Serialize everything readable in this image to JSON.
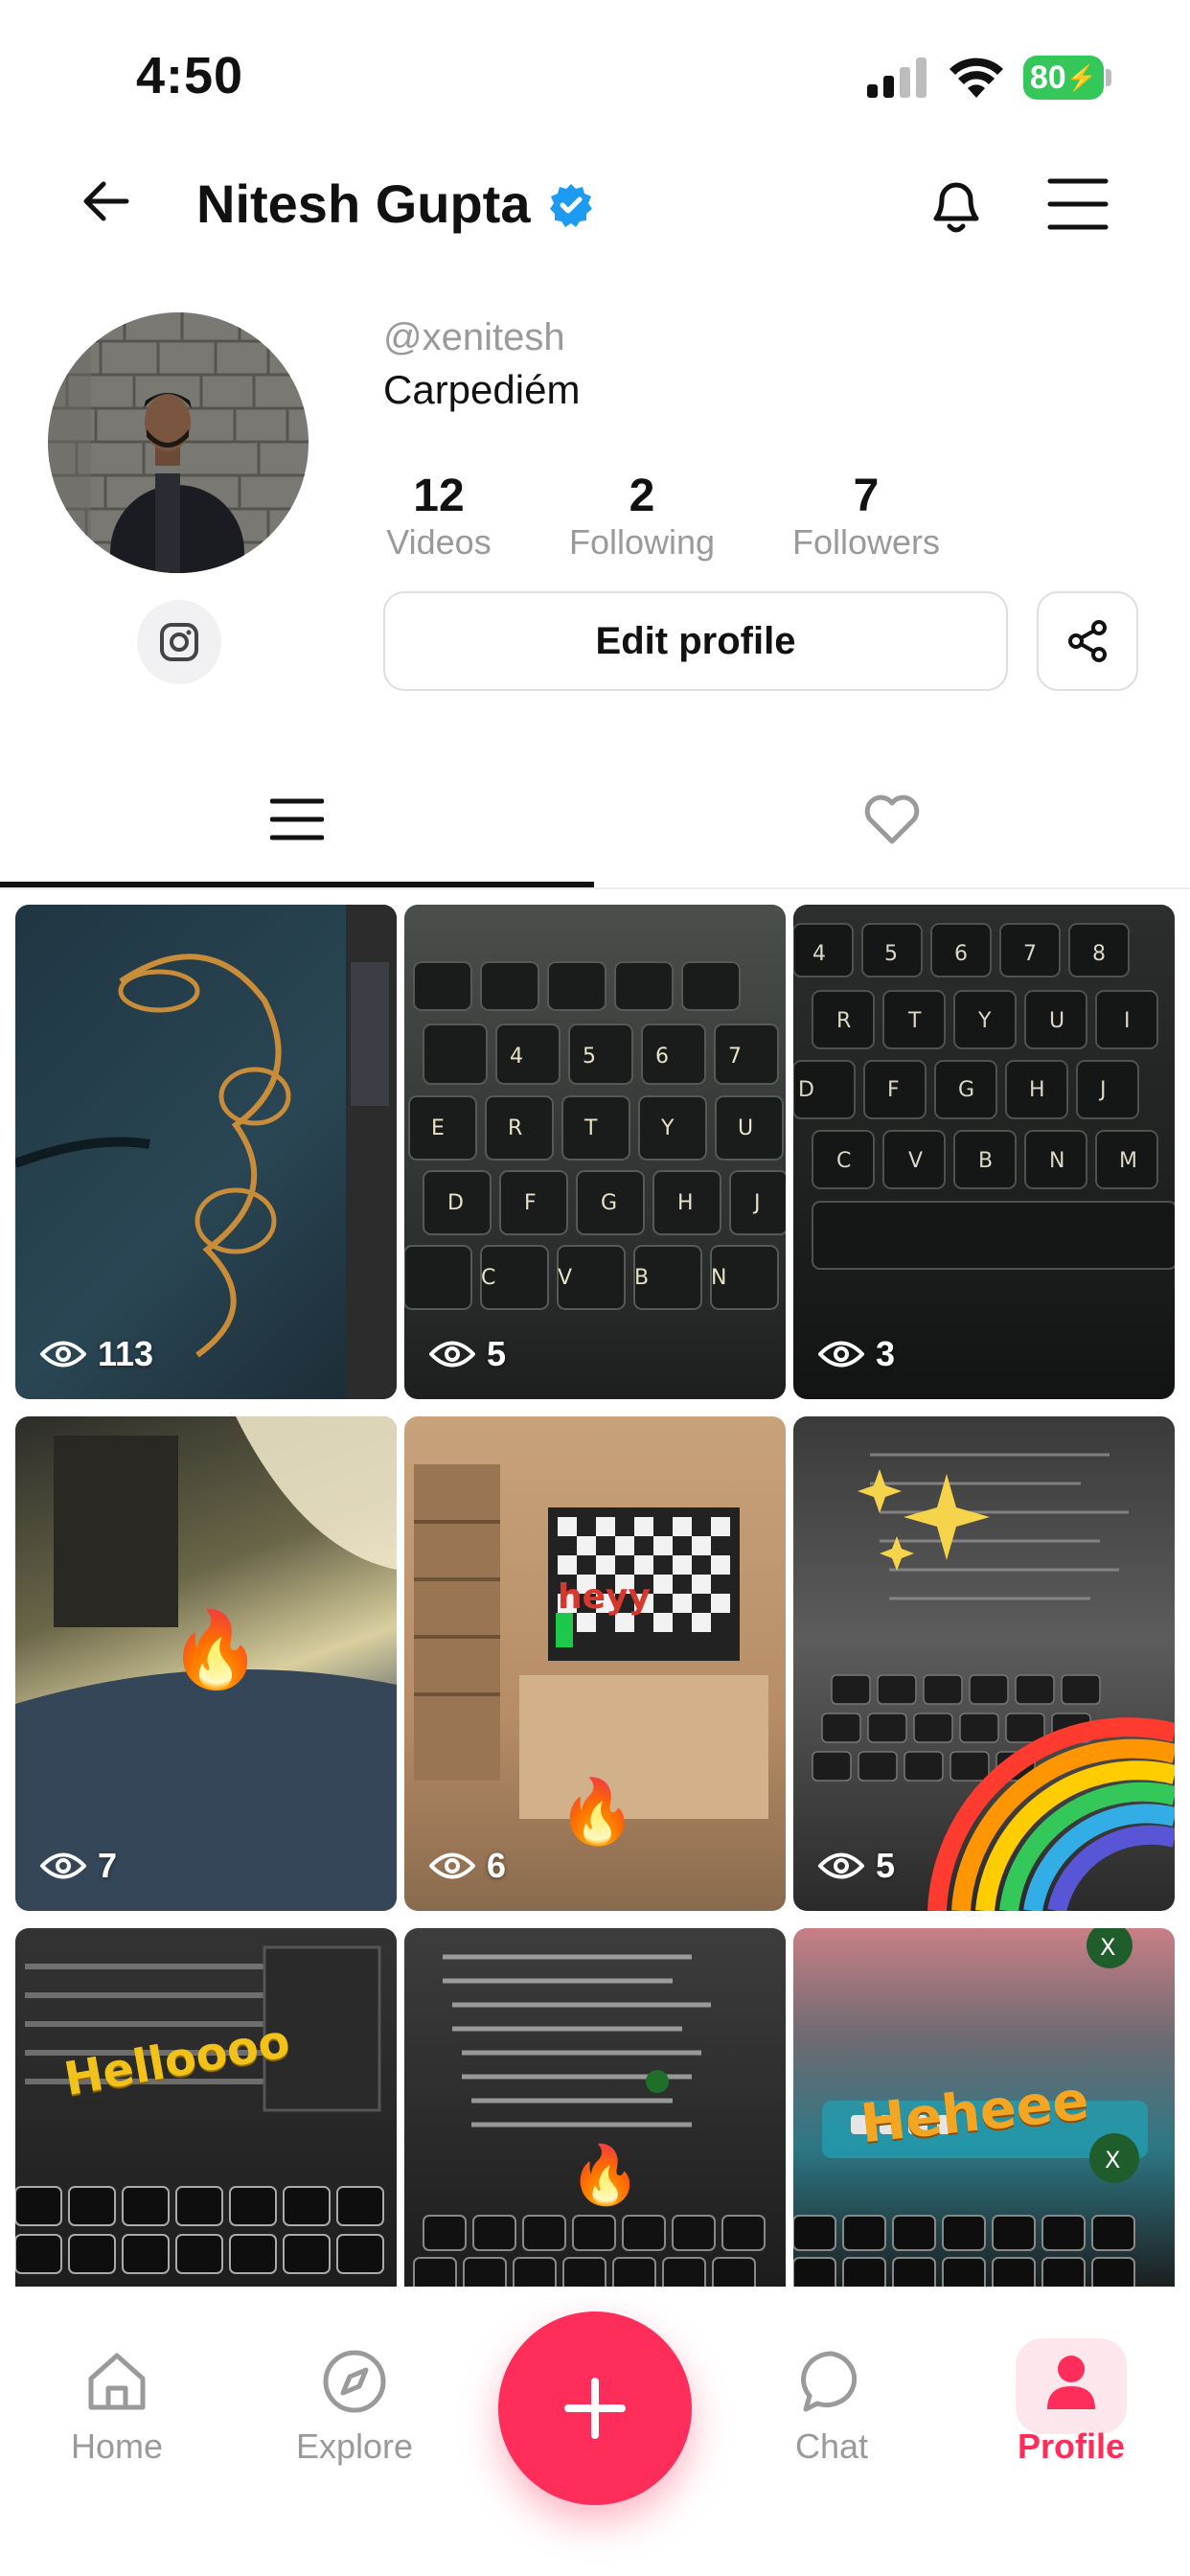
{
  "status_bar": {
    "time": "4:50",
    "battery": "80"
  },
  "header": {
    "name": "Nitesh Gupta"
  },
  "profile": {
    "handle": "@xenitesh",
    "bio": "Carpediém",
    "stats": [
      {
        "value": "12",
        "label": "Videos"
      },
      {
        "value": "2",
        "label": "Following"
      },
      {
        "value": "7",
        "label": "Followers"
      }
    ],
    "edit_label": "Edit profile"
  },
  "videos": [
    {
      "views": "113",
      "overlay": ""
    },
    {
      "views": "5",
      "overlay": ""
    },
    {
      "views": "3",
      "overlay": ""
    },
    {
      "views": "7",
      "overlay": "🔥"
    },
    {
      "views": "6",
      "overlay": "heyy"
    },
    {
      "views": "5",
      "overlay": "✨"
    },
    {
      "views": "",
      "overlay": "Helloooo"
    },
    {
      "views": "",
      "overlay": "🔥"
    },
    {
      "views": "",
      "overlay": "Heheee"
    }
  ],
  "nav": [
    {
      "label": "Home",
      "icon": "home-icon"
    },
    {
      "label": "Explore",
      "icon": "compass-icon"
    },
    {
      "label": "Chat",
      "icon": "chat-icon"
    },
    {
      "label": "Profile",
      "icon": "person-icon"
    }
  ],
  "colors": {
    "accent": "#ff2d5a",
    "verified": "#1d9bf0",
    "battery": "#34c759"
  }
}
